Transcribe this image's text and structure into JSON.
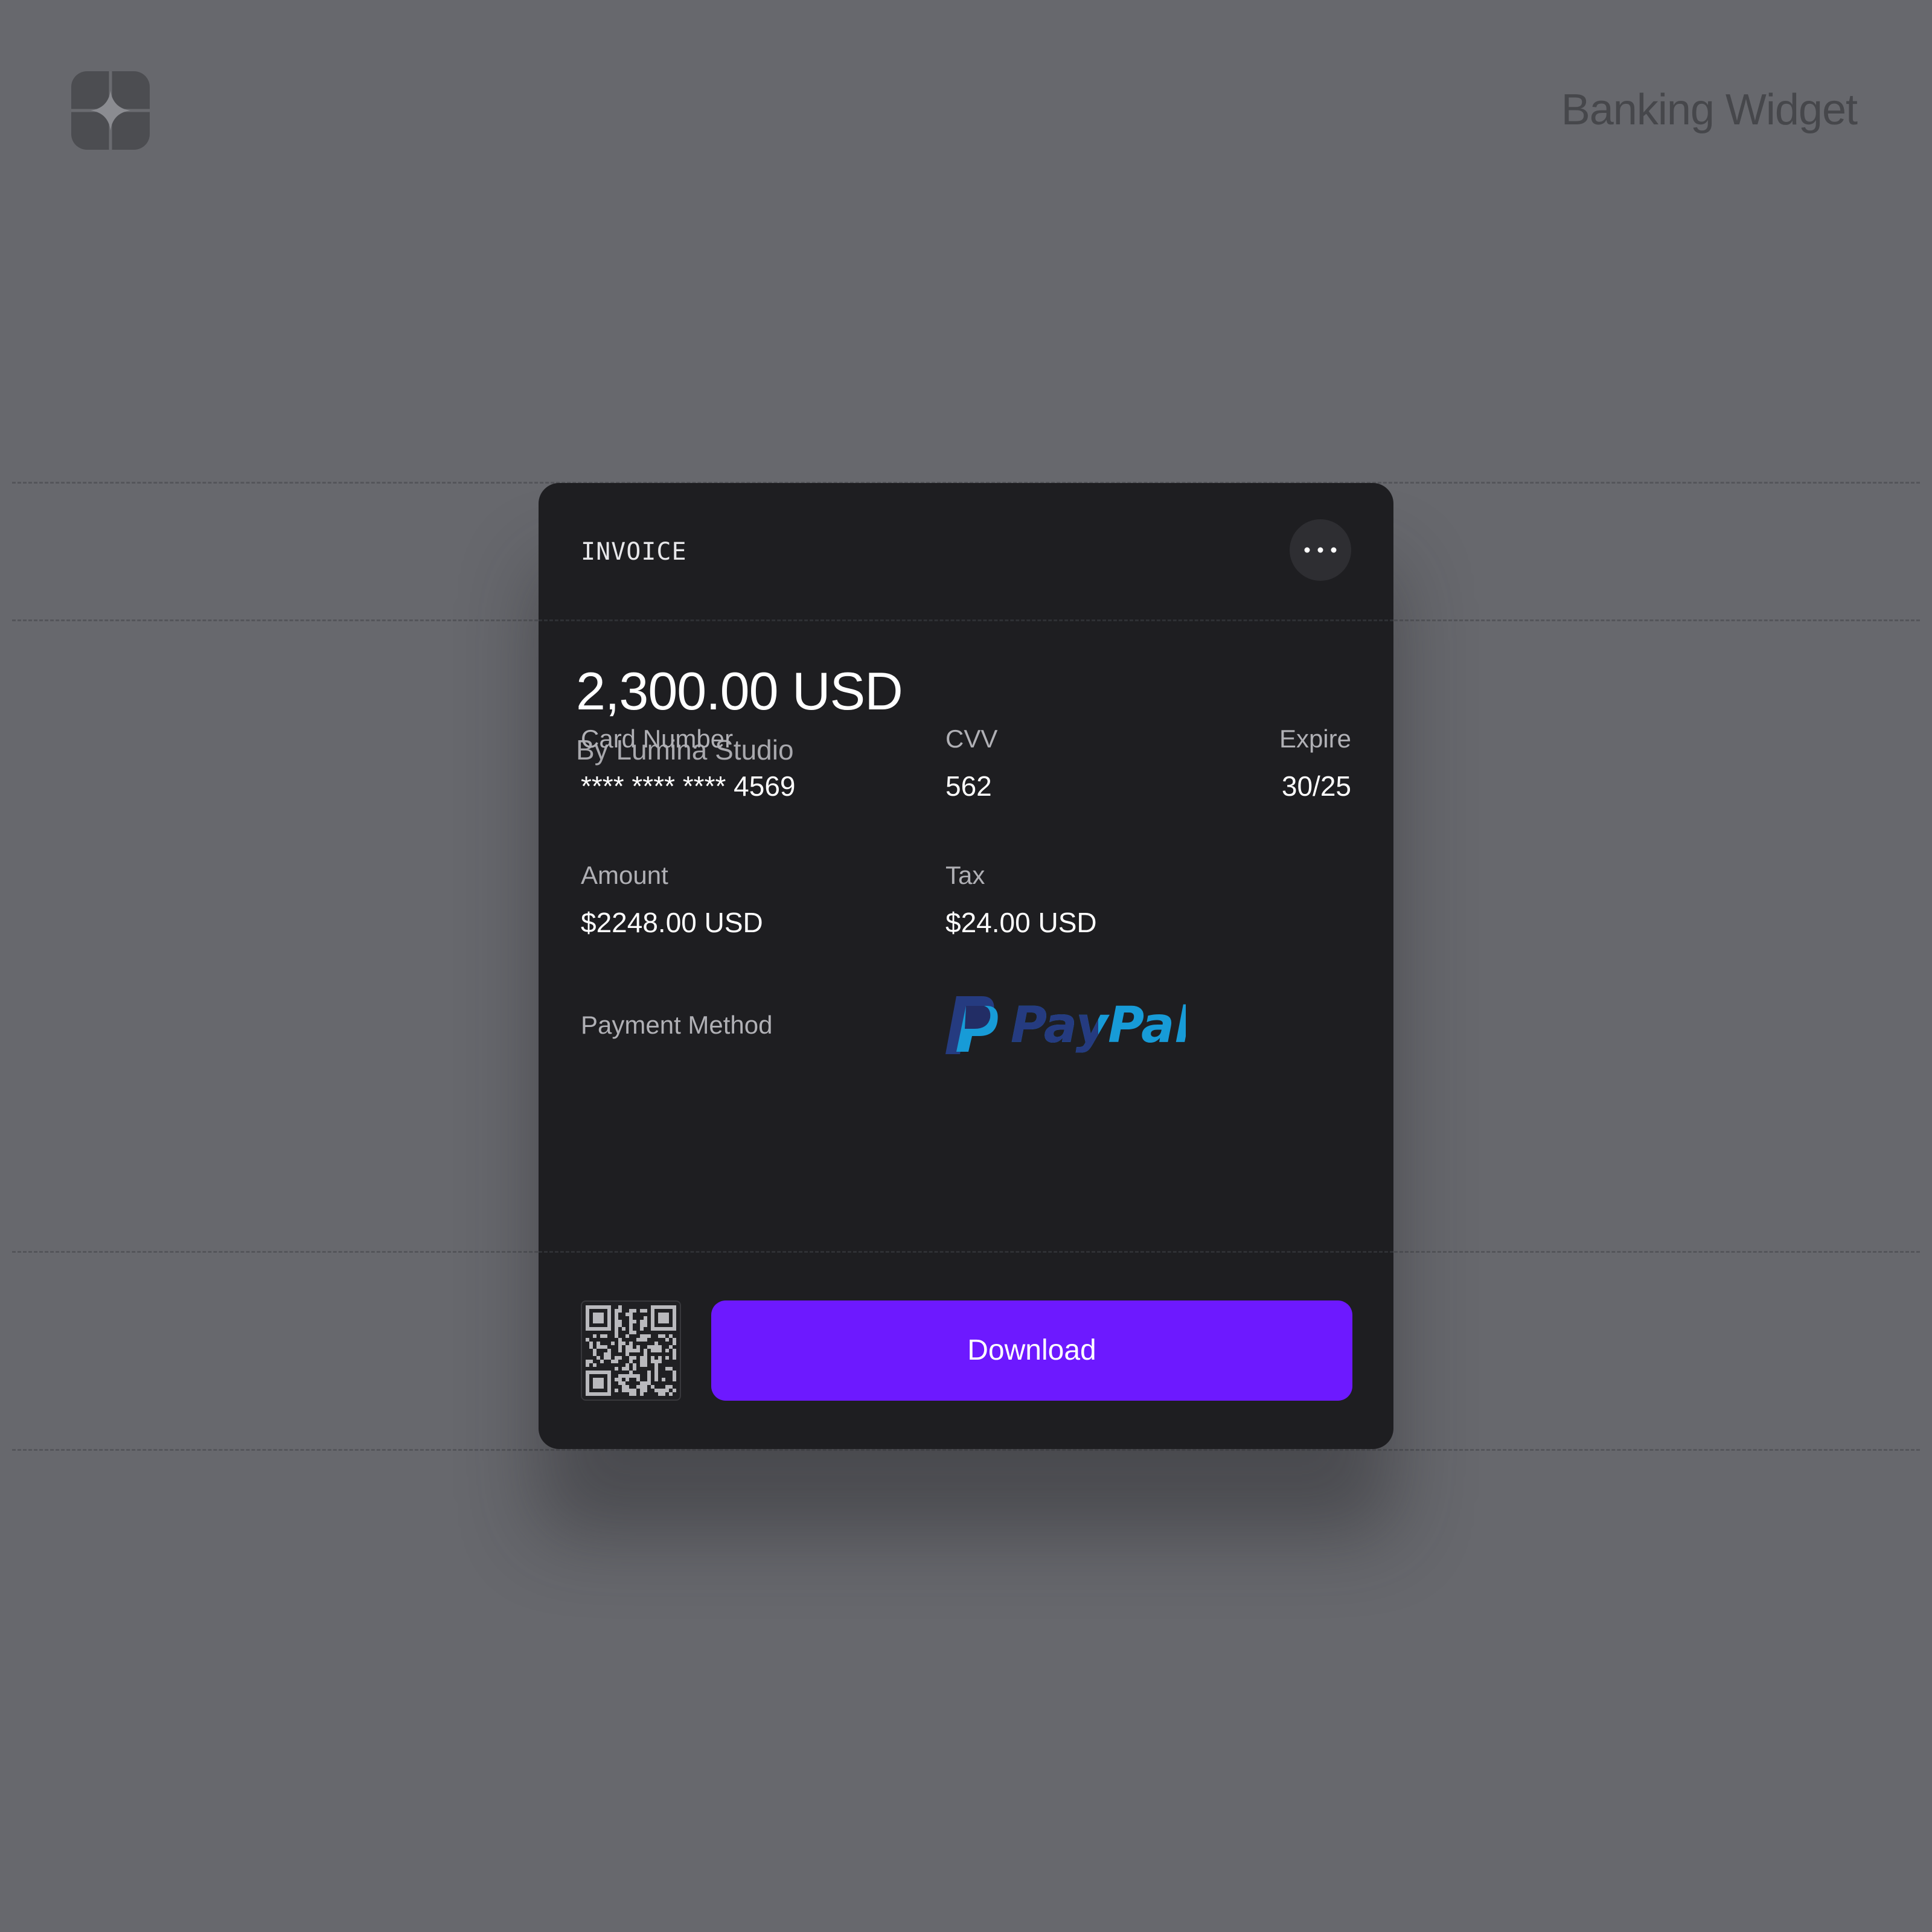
{
  "page": {
    "title": "Banking Widget",
    "logo_icon": "sparkle-icon"
  },
  "invoice": {
    "label": "INVOICE",
    "menu_icon": "more-horizontal-icon",
    "total": "2,300.00 USD",
    "issuer": "By Lumina Studio",
    "card_number_label": "Card Number",
    "card_number": "**** **** **** 4569",
    "cvv_label": "CVV",
    "cvv": "562",
    "expire_label": "Expire",
    "expire": "30/25",
    "amount_label": "Amount",
    "amount": "$2248.00 USD",
    "tax_label": "Tax",
    "tax": "$24.00 USD",
    "payment_method_label": "Payment Method",
    "payment_method_logo_text": "PayPal",
    "qr_icon": "qr-code-icon",
    "download_label": "Download"
  },
  "colors": {
    "background": "#67686d",
    "card": "#1e1e21",
    "accent": "#6d19ff",
    "paypal_dark_blue": "#253b80",
    "paypal_light_blue": "#179bd7"
  }
}
